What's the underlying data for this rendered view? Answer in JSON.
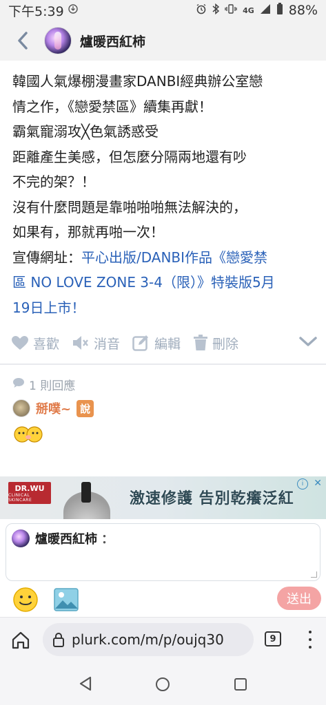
{
  "status_bar": {
    "time": "下午5:39",
    "network": "4G",
    "battery": "88%"
  },
  "header": {
    "username": "爐暖西紅柿"
  },
  "post": {
    "line1": "韓國人氣爆棚漫畫家DANBI經典辦公室戀",
    "line2": "情之作，《戀愛禁區》續集再獻！",
    "line3": "霸氣寵溺攻╳色氣誘惑受",
    "line4": "距離產生美感，但怎麼分隔兩地還有吵",
    "line5": "不完的架？！",
    "line6": "沒有什麼問題是靠啪啪啪無法解決的，",
    "line7": "如果有，那就再啪一次！",
    "promo_prefix": "宣傳網址：",
    "link_line1": "平心出版/DANBI作品《戀愛禁",
    "link_line2": "區 NO LOVE ZONE 3-4（限）》特裝版5月",
    "link_line3": "19日上市！"
  },
  "actions": {
    "like": "喜歡",
    "mute": "消音",
    "edit": "編輯",
    "delete": "刪除"
  },
  "responses": {
    "count_label": "1 則回應",
    "reply_author": "掰噗~",
    "reply_qualifier": "說"
  },
  "ad": {
    "brand": "DR.WU",
    "brand_sub": "CLINICAL SKINCARE",
    "headline": "激速修護 告別乾癢泛紅",
    "info_glyph": "i",
    "close_glyph": "✕"
  },
  "reply_box": {
    "username": "爐暖西紅柿",
    "colon": "："
  },
  "composer": {
    "send_label": "送出"
  },
  "browser": {
    "url": "plurk.com/m/p/oujq30",
    "tab_count": "9"
  },
  "colors": {
    "link": "#2a61b8",
    "muted": "#a0adbd",
    "reply_name": "#e07b4a",
    "send_bg": "#f4a4a4"
  }
}
